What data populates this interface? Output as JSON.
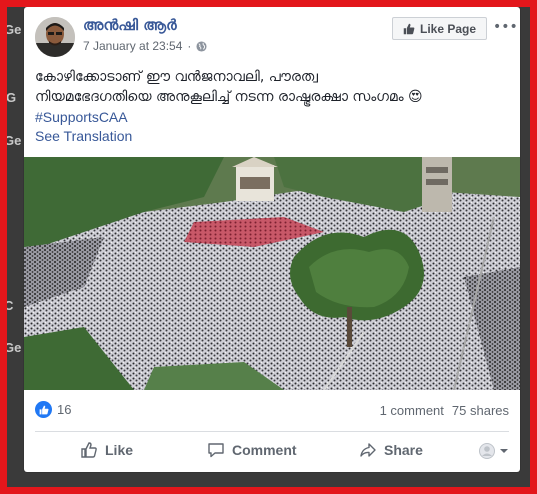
{
  "background": {
    "text_fragments": [
      "Ge",
      "G",
      "Ge",
      "C",
      "Ge"
    ]
  },
  "post": {
    "author": "അൻഷി ആർ",
    "timestamp": "7 January at 23:54",
    "privacy_icon": "globe-icon",
    "like_page_label": "Like Page",
    "more_label": "•••",
    "text_line1": "കോഴിക്കോടാണ് ഈ വൻജനാവലി, പൗരത്വ",
    "text_line2": "നിയമഭേദഗതിയെ അനുകൂലിച്ച് നടന്ന രാഷ്ട്രരക്ഷാ സംഗമം 😍",
    "hashtag": "#SupportsCAA",
    "see_translation": "See Translation"
  },
  "stats": {
    "reaction_icon": "thumbs-up-icon",
    "reaction_count": "16",
    "comments": "1 comment",
    "shares": "75 shares"
  },
  "actions": {
    "like": "Like",
    "comment": "Comment",
    "share": "Share"
  },
  "colors": {
    "frame": "#e3161b",
    "link": "#385898",
    "reaction": "#2078f4"
  }
}
